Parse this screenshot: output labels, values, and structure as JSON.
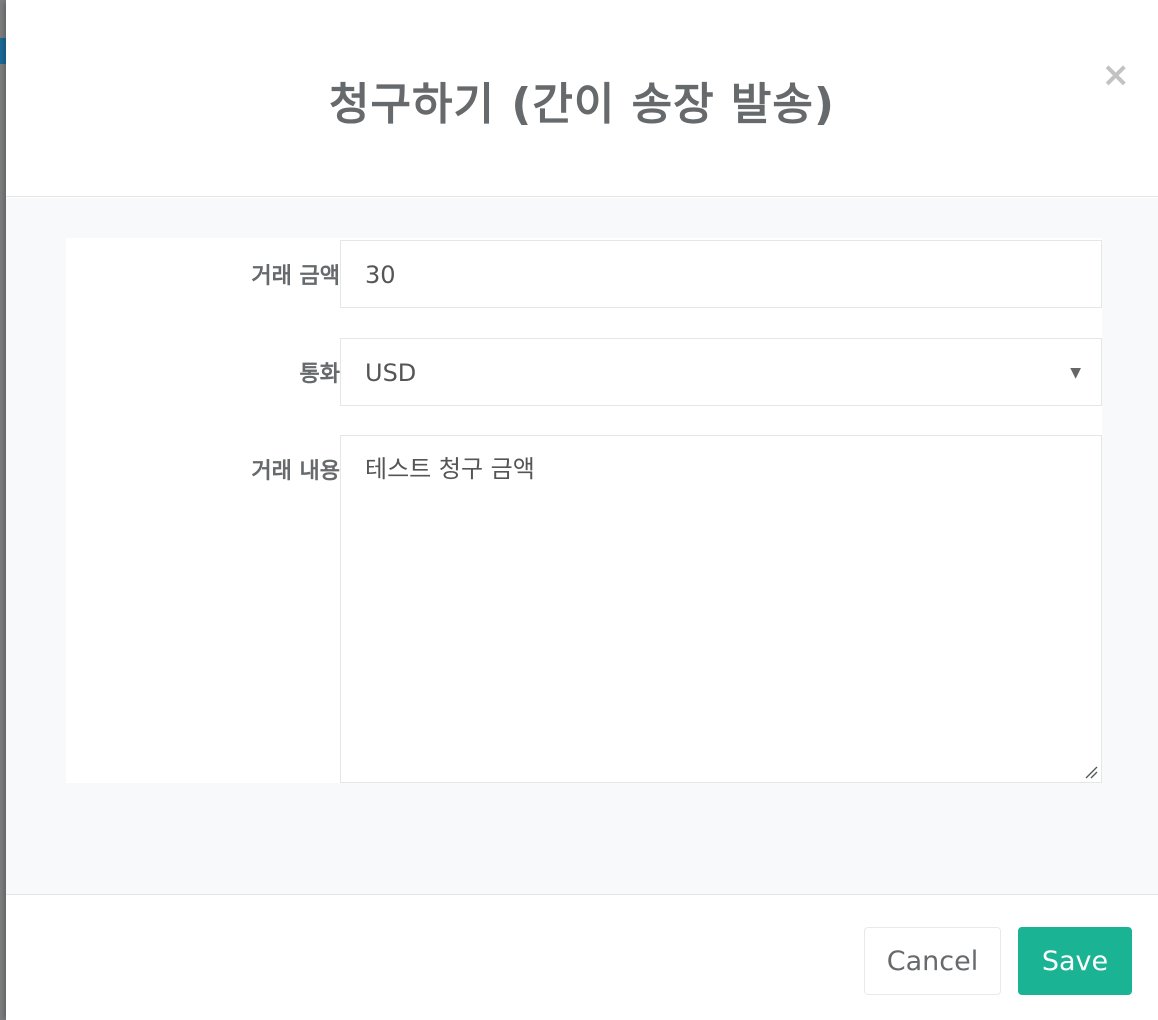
{
  "modal": {
    "title": "청구하기 (간이 송장 발송)",
    "close_icon": "×"
  },
  "form": {
    "amount": {
      "label": "거래 금액",
      "value": "30"
    },
    "currency": {
      "label": "통화",
      "value": "USD"
    },
    "description": {
      "label": "거래 내용",
      "value": "테스트 청구 금액"
    }
  },
  "footer": {
    "cancel_label": "Cancel",
    "save_label": "Save"
  },
  "colors": {
    "accent": "#1ab394",
    "title_text": "#676a6c",
    "body_bg": "#f8f9fb"
  }
}
